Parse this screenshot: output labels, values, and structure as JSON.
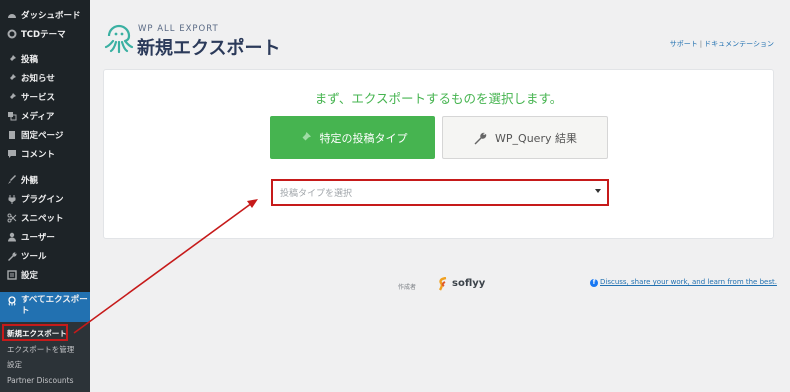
{
  "sidebar": {
    "items": [
      {
        "label": "ダッシュボード",
        "icon": "dashboard-icon"
      },
      {
        "label": "TCDテーマ",
        "icon": "gear-icon"
      },
      {
        "label": "投稿",
        "icon": "pin-icon"
      },
      {
        "label": "お知らせ",
        "icon": "pin-icon"
      },
      {
        "label": "サービス",
        "icon": "pin-icon"
      },
      {
        "label": "メディア",
        "icon": "media-icon"
      },
      {
        "label": "固定ページ",
        "icon": "page-icon"
      },
      {
        "label": "コメント",
        "icon": "comment-icon"
      },
      {
        "label": "外観",
        "icon": "brush-icon"
      },
      {
        "label": "プラグイン",
        "icon": "plugin-icon"
      },
      {
        "label": "スニペット",
        "icon": "scissors-icon"
      },
      {
        "label": "ユーザー",
        "icon": "user-icon"
      },
      {
        "label": "ツール",
        "icon": "wrench-icon"
      },
      {
        "label": "設定",
        "icon": "settings-icon"
      }
    ],
    "active": {
      "label_line1": "すべてエクスポー",
      "label_line2": "ト",
      "icon": "export-icon"
    },
    "submenu": [
      {
        "label": "新規エクスポート"
      },
      {
        "label": "エクスポートを管理"
      },
      {
        "label": "設定"
      },
      {
        "label": "Partner Discounts"
      }
    ]
  },
  "header": {
    "brand_small": "WP ALL EXPORT",
    "title": "新規エクスポート",
    "link_support": "サポート",
    "link_separator": "|",
    "link_docs": "ドキュメンテーション"
  },
  "main": {
    "question": "まず、エクスポートするものを選択します。",
    "btn_post_type": "特定の投稿タイプ",
    "btn_wpquery": "WP_Query 結果",
    "select_placeholder": "投稿タイプを選択"
  },
  "footer": {
    "made_by": "作成者",
    "brand": "soflyy",
    "discuss": "Discuss, share your work, and learn from the best."
  },
  "colors": {
    "sidebar_bg": "#1d2327",
    "active_bg": "#2271b1",
    "accent_green": "#46b450",
    "highlight_red": "#c61a1a",
    "link_blue": "#2271b1"
  }
}
